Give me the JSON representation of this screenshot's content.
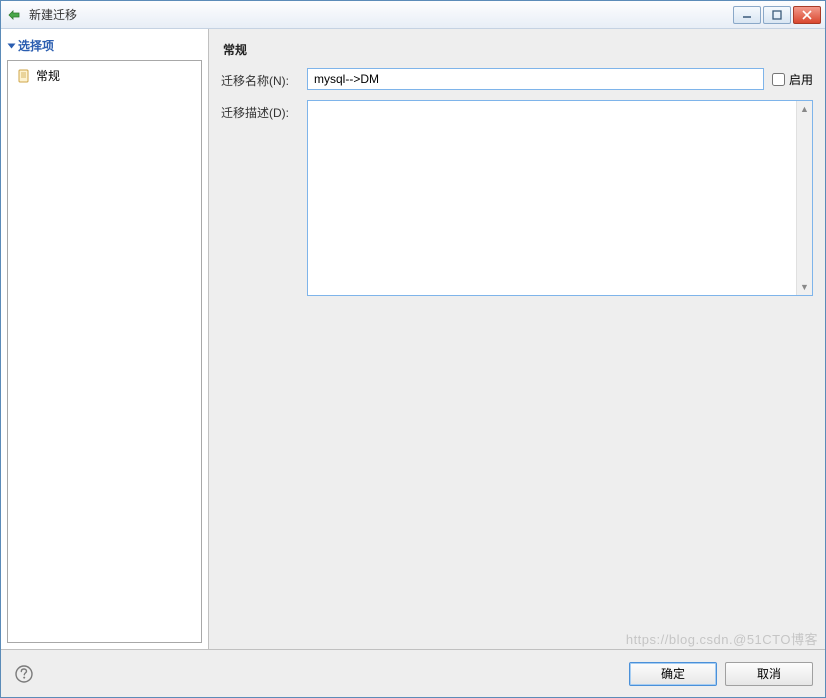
{
  "window": {
    "title": "新建迁移"
  },
  "sidebar": {
    "header": "选择项",
    "items": [
      {
        "label": "常规"
      }
    ]
  },
  "main": {
    "section_title": "常规",
    "name_label": "迁移名称(N):",
    "name_value": "mysql-->DM",
    "enable_label": "启用",
    "enable_checked": false,
    "desc_label": "迁移描述(D):",
    "desc_value": ""
  },
  "footer": {
    "ok": "确定",
    "cancel": "取消"
  },
  "watermark": "https://blog.csdn.@51CTO博客"
}
